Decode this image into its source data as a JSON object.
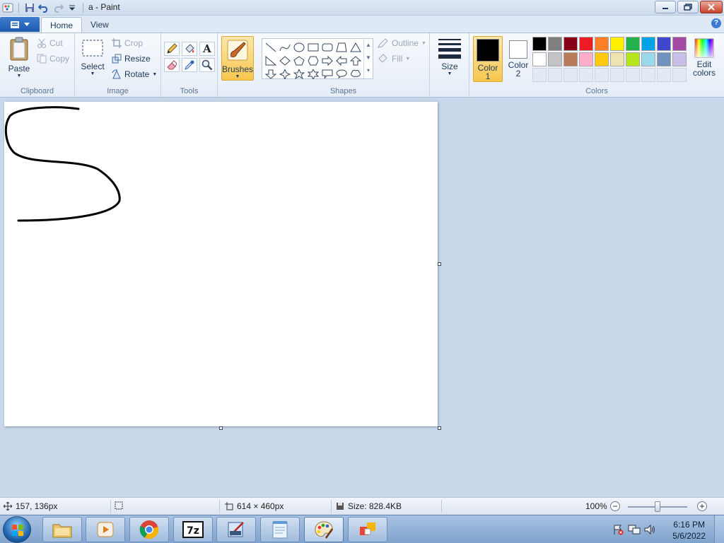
{
  "window": {
    "title": "a - Paint"
  },
  "tabs": {
    "app_menu": "",
    "home": "Home",
    "view": "View"
  },
  "ribbon": {
    "clipboard": {
      "label": "Clipboard",
      "paste": "Paste",
      "cut": "Cut",
      "copy": "Copy"
    },
    "image": {
      "label": "Image",
      "select": "Select",
      "crop": "Crop",
      "resize": "Resize",
      "rotate": "Rotate"
    },
    "tools": {
      "label": "Tools"
    },
    "brushes": {
      "label": "Brushes"
    },
    "shapes": {
      "label": "Shapes",
      "outline": "Outline",
      "fill": "Fill"
    },
    "size": {
      "label": "Size"
    },
    "colors": {
      "label": "Colors",
      "color1": "Color",
      "color1_num": "1",
      "color2": "Color",
      "color2_num": "2",
      "edit": "Edit",
      "edit2": "colors",
      "color1_value": "#000000",
      "color2_value": "#ffffff",
      "palette": [
        "#000000",
        "#7f7f7f",
        "#880015",
        "#ed1c24",
        "#ff7f27",
        "#fff200",
        "#22b14c",
        "#00a2e8",
        "#3f48cc",
        "#a349a4",
        "#ffffff",
        "#c3c3c3",
        "#b97a57",
        "#ffaec9",
        "#ffc90e",
        "#efe4b0",
        "#b5e61d",
        "#99d9ea",
        "#7092be",
        "#c8bfe7"
      ]
    }
  },
  "statusbar": {
    "cursor_pos": "157, 136px",
    "canvas_size": "614 × 460px",
    "file_size": "Size: 828.4KB",
    "zoom": "100%",
    "zoom_level": 0.5
  },
  "taskbar": {
    "time": "6:16 PM",
    "date": "5/6/2022"
  }
}
